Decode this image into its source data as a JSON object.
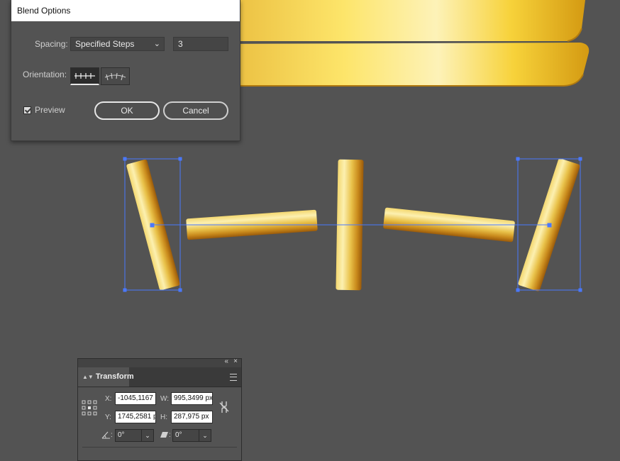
{
  "dialog": {
    "title": "Blend Options",
    "spacing_label": "Spacing:",
    "spacing_value": "Specified Steps",
    "steps_value": "3",
    "orientation_label": "Orientation:",
    "orientation_options": [
      "align-to-page-icon",
      "align-to-path-icon"
    ],
    "preview_label": "Preview",
    "preview_checked": true,
    "ok_label": "OK",
    "cancel_label": "Cancel"
  },
  "transform": {
    "title": "Transform",
    "x_label": "X:",
    "x_value": "-1045,1167",
    "y_label": "Y:",
    "y_value": "1745,2581 p",
    "w_label": "W:",
    "w_value": "995,3499 px",
    "h_label": "H:",
    "h_value": "287,975 px",
    "rotate_value": "0°",
    "shear_value": "0°"
  },
  "colors": {
    "canvas": "#535353",
    "gold_light": "#fdf0a8",
    "gold": "#e9c24a",
    "gold_dark": "#b86a10",
    "selection": "#4a78ff"
  }
}
